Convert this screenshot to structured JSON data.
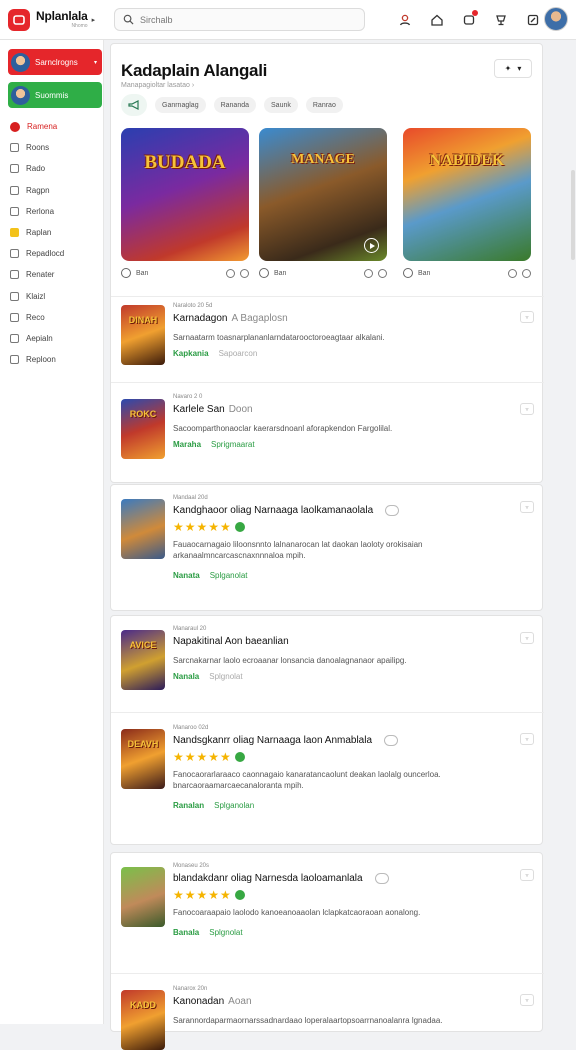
{
  "app": {
    "title": "Nplanlala",
    "subtitle": "Nhomo"
  },
  "search": {
    "placeholder": "Sirchalb"
  },
  "topbar_icons": [
    "person-pin-icon",
    "home-icon",
    "notification-icon",
    "trophy-icon",
    "edit-icon"
  ],
  "sidebar": {
    "btn1": "Sarnclrogns",
    "btn2": "Suommis",
    "items": [
      {
        "label": "Ramena",
        "active": true
      },
      {
        "label": "Roons"
      },
      {
        "label": "Rado"
      },
      {
        "label": "Ragpn"
      },
      {
        "label": "Rerlona"
      },
      {
        "label": "Raplan"
      },
      {
        "label": "Repadlocd"
      },
      {
        "label": "Renater"
      },
      {
        "label": "Klaizl"
      },
      {
        "label": "Reco"
      },
      {
        "label": "Aepialn"
      },
      {
        "label": "Reploon"
      }
    ]
  },
  "main": {
    "title": "Kadaplain Alangali",
    "subtitle": "Manapagioltar lasatao ›",
    "chips": [
      "Ganrnaglag",
      "Rananda",
      "Saunk",
      "Ranrao"
    ],
    "featured": [
      {
        "title": "BUDADA",
        "meta": "Ban"
      },
      {
        "title": "MANAGE",
        "meta": "Ban"
      },
      {
        "title": "NABIDEK",
        "meta": "Ban"
      }
    ]
  },
  "list": [
    {
      "small": "Naraloto 20 5d",
      "title": "Karnadagon",
      "light": "A  Bagaplosn",
      "desc": "Sarnaatarm toasnarplananlarndatarooctoroeagtaar alkalani.",
      "tag1": "Kapkania",
      "tag2": "Sapoarcon",
      "thumb": "DINAH"
    },
    {
      "small": "Navaro 2 0",
      "title": "Karlele San",
      "light": "Doon",
      "desc": "Sacoomparthonaoclar kaerarsdnoanl aforapkendon Fargolilal.",
      "tag1": "Maraha",
      "tag2": "Sprigmaarat",
      "thumb": "ROKC"
    },
    {
      "small": "Mandaal 20d",
      "title": "Kandghaoor oliag Narnaaga laolkamanaolala",
      "light": "",
      "stars": "★★★★★",
      "desc": "Fauaocarnagaio liloonsnnto lalnanarocan lat daokan laoloty orokisaian arkanaalmncarcascnaxnnnaloa mpih.",
      "tag1": "Nanata",
      "tag2": "Splganolat",
      "thumb": ""
    },
    {
      "small": "Manaraul 20",
      "title": "Napakitinal Aon baeanlian",
      "light": "",
      "desc": "Sarcnakarnar laolo ecroaanar lonsancia danoalagnanaor apailipg.",
      "tag1": "Nanala",
      "tag2": "Splgnolat",
      "thumb": "AVICE"
    },
    {
      "small": "Manaroo 02d",
      "title": "Nandsgkanrr oliag Narnaaga laon Anmablala",
      "light": "",
      "stars": "★★★★★",
      "desc": "Fanocaorarlaraaco caonnagaio kanaratancaolunt deakan laolalg ouncerloa. bnarcaoraamarcaecanaloranta mpih.",
      "tag1": "Ranalan",
      "tag2": "Splganolan",
      "thumb": "DEAVH"
    },
    {
      "small": "Monaseu 20s",
      "title": "blandakdanr oliag Narnesda laoloamanlala",
      "light": "",
      "stars": "★★★★★",
      "desc": "Fanocoaraapaio laolodo kanoeanoaaolan lclapkatcaoraoan aonalong.",
      "tag1": "Banala",
      "tag2": "Splgnolat",
      "thumb": ""
    },
    {
      "small": "Nanarox 20n",
      "title": "Kanonadan",
      "light": "Aoan",
      "desc": "Sarannordaparmaornarssadnardaao loperalaartopsoarrnanoalanra lgnadaa.",
      "tag1": "",
      "tag2": "",
      "thumb": "KADD"
    }
  ]
}
